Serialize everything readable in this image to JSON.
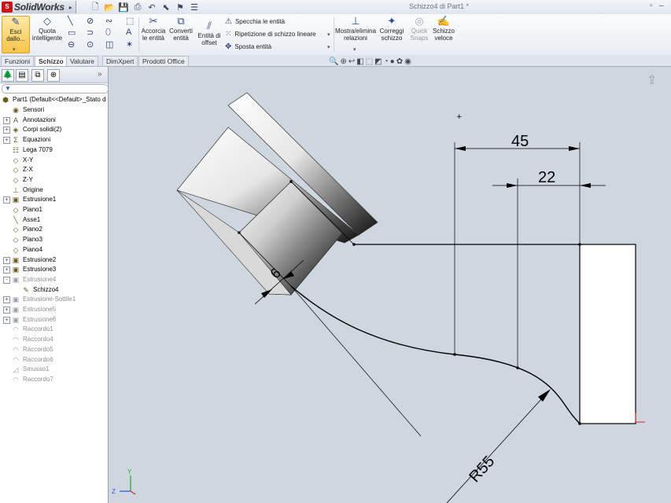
{
  "titlebar": {
    "brand": "SolidWorks",
    "logo_text": "S",
    "document_title": "Schizzo4 di Part1 *"
  },
  "ribbon": {
    "exit_sketch": "Esci dallo...",
    "smart_dimension": "Quota intelligente",
    "trim": "Accorcia le entità",
    "convert": "Converti entità",
    "offset": "Entità di offset",
    "mirror": "Specchia le entità",
    "linear_pattern": "Ripetizione di schizzo lineare",
    "move": "Sposta entità",
    "relations": "Mostra/elimina relazioni",
    "repair": "Correggi schizzo",
    "quick_snaps": "Quick Snaps",
    "rapid_sketch": "Schizzo veloce"
  },
  "tabs": [
    "Funzioni",
    "Schizzo",
    "Valutare",
    "DimXpert",
    "Prodotti Office"
  ],
  "active_tab": "Schizzo",
  "tree": {
    "root": "Part1  (Default<<Default>_Stato d",
    "items": [
      {
        "label": "Sensori",
        "icon": "sensor-icon",
        "expand": "",
        "gray": false
      },
      {
        "label": "Annotazioni",
        "icon": "annotation-icon",
        "expand": "+",
        "gray": false
      },
      {
        "label": "Corpi solidi(2)",
        "icon": "solid-bodies-icon",
        "expand": "+",
        "gray": false
      },
      {
        "label": "Equazioni",
        "icon": "equation-icon",
        "expand": "+",
        "gray": false
      },
      {
        "label": "Lega 7079",
        "icon": "material-icon",
        "expand": "",
        "gray": false
      },
      {
        "label": "X-Y",
        "icon": "plane-icon",
        "expand": "",
        "gray": false
      },
      {
        "label": "Z-X",
        "icon": "plane-icon",
        "expand": "",
        "gray": false
      },
      {
        "label": "Z-Y",
        "icon": "plane-icon",
        "expand": "",
        "gray": false
      },
      {
        "label": "Origine",
        "icon": "origin-icon",
        "expand": "",
        "gray": false
      },
      {
        "label": "Estrusione1",
        "icon": "extrude-icon",
        "expand": "+",
        "gray": false
      },
      {
        "label": "Piano1",
        "icon": "plane-icon",
        "expand": "",
        "gray": false
      },
      {
        "label": "Asse1",
        "icon": "axis-icon",
        "expand": "",
        "gray": false
      },
      {
        "label": "Piano2",
        "icon": "plane-icon",
        "expand": "",
        "gray": false
      },
      {
        "label": "Piano3",
        "icon": "plane-icon",
        "expand": "",
        "gray": false
      },
      {
        "label": "Piano4",
        "icon": "plane-icon",
        "expand": "",
        "gray": false
      },
      {
        "label": "Estrusione2",
        "icon": "extrude-icon",
        "expand": "+",
        "gray": false
      },
      {
        "label": "Estrusione3",
        "icon": "extrude-icon",
        "expand": "+",
        "gray": false
      },
      {
        "label": "Estrusione4",
        "icon": "extrude-icon",
        "expand": "-",
        "gray": true
      },
      {
        "label": "Schizzo4",
        "icon": "sketch-icon",
        "expand": "",
        "gray": false,
        "indent": true
      },
      {
        "label": "Estrusione-Sottile1",
        "icon": "extrude-icon",
        "expand": "+",
        "gray": true
      },
      {
        "label": "Estrusione5",
        "icon": "extrude-icon",
        "expand": "+",
        "gray": true
      },
      {
        "label": "Estrusione6",
        "icon": "extrude-icon",
        "expand": "+",
        "gray": true
      },
      {
        "label": "Raccordo1",
        "icon": "fillet-icon",
        "expand": "",
        "gray": true
      },
      {
        "label": "Raccordo4",
        "icon": "fillet-icon",
        "expand": "",
        "gray": true
      },
      {
        "label": "Raccordo5",
        "icon": "fillet-icon",
        "expand": "",
        "gray": true
      },
      {
        "label": "Raccordo6",
        "icon": "fillet-icon",
        "expand": "",
        "gray": true
      },
      {
        "label": "Smusso1",
        "icon": "chamfer-icon",
        "expand": "",
        "gray": true
      },
      {
        "label": "Raccordo7",
        "icon": "fillet-icon",
        "expand": "",
        "gray": true
      }
    ]
  },
  "dimensions": {
    "d45": "45",
    "d22": "22",
    "d6": "6",
    "radius": "R55"
  },
  "triad": {
    "y": "Y",
    "z": "Z"
  },
  "colors": {
    "sketch_line": "#000000",
    "viewport_bg": "#ced6e0",
    "accent_red": "#e02020"
  }
}
